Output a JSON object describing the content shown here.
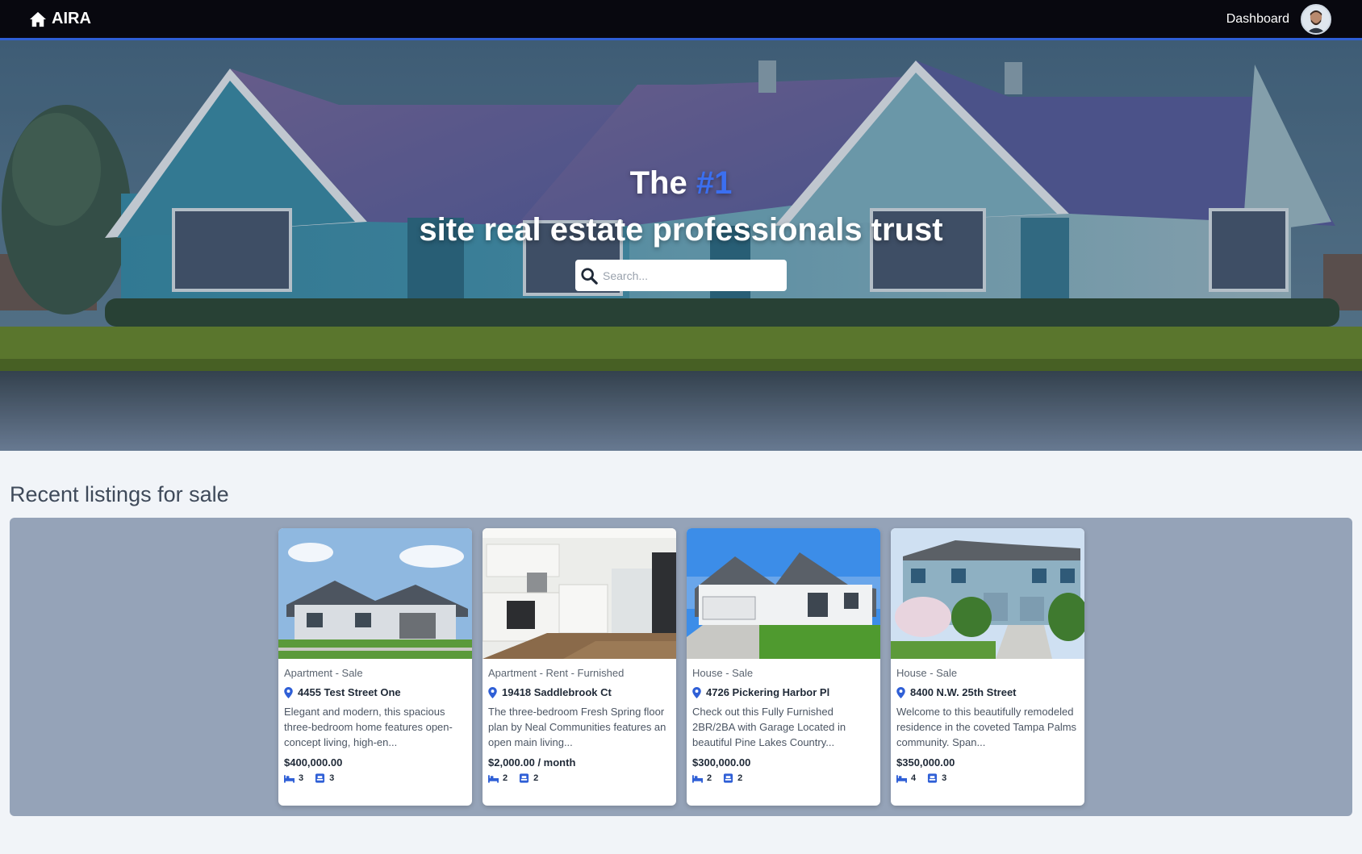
{
  "nav": {
    "brand": "AIRA",
    "dashboard_label": "Dashboard"
  },
  "hero": {
    "title_before": "The ",
    "title_accent": "#1",
    "title_after": " site real estate professionals trust",
    "search_placeholder": "Search..."
  },
  "listings": {
    "heading": "Recent listings for sale",
    "items": [
      {
        "type": "Apartment - Sale",
        "address": "4455 Test Street One",
        "description": "Elegant and modern, this spacious three-bedroom home features open-concept living, high-en...",
        "price": "$400,000.00",
        "beds": "3",
        "baths": "3"
      },
      {
        "type": "Apartment - Rent - Furnished",
        "address": "19418 Saddlebrook Ct",
        "description": "The three-bedroom Fresh Spring floor plan by Neal Communities features an open main living...",
        "price": "$2,000.00 / month",
        "beds": "2",
        "baths": "2"
      },
      {
        "type": "House - Sale",
        "address": "4726 Pickering Harbor Pl",
        "description": "Check out this Fully Furnished 2BR/2BA with Garage Located in beautiful Pine Lakes Country...",
        "price": "$300,000.00",
        "beds": "2",
        "baths": "2"
      },
      {
        "type": "House - Sale",
        "address": "8400 N.W. 25th Street",
        "description": "Welcome to this beautifully remodeled residence in the coveted Tampa Palms community. Span...",
        "price": "$350,000.00",
        "beds": "4",
        "baths": "3"
      }
    ]
  },
  "icons": {
    "brand": "home-icon",
    "search": "search-icon",
    "location": "location-pin-icon",
    "beds": "bed-icon",
    "baths": "bath-icon"
  },
  "colors": {
    "navbar_bg": "#08080f",
    "navbar_accent_line": "#2f5fd6",
    "accent_blue": "#3b6ff0",
    "listings_panel": "#95a3b8",
    "page_bg": "#f1f4f8"
  }
}
